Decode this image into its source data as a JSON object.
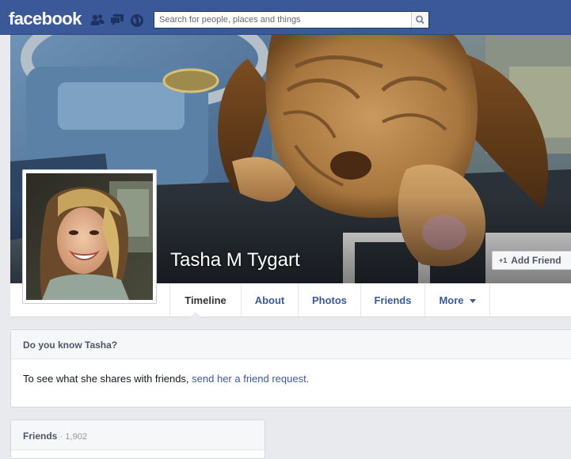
{
  "header": {
    "logo": "facebook",
    "search_placeholder": "Search for people, places and things",
    "jewels": [
      "friend-requests-icon",
      "messages-icon",
      "notifications-globe-icon"
    ],
    "brand_color": "#3b5998"
  },
  "profile": {
    "name": "Tasha M Tygart",
    "add_friend_label": "Add Friend",
    "add_friend_icon": "+1"
  },
  "tabs": [
    {
      "label": "Timeline",
      "active": true
    },
    {
      "label": "About"
    },
    {
      "label": "Photos"
    },
    {
      "label": "Friends"
    },
    {
      "label": "More"
    }
  ],
  "know_card": {
    "title": "Do you know Tasha?",
    "body_text": "To see what she shares with friends, ",
    "link_text": "send her a friend request."
  },
  "friends_card": {
    "title": "Friends",
    "count": "· 1,902"
  }
}
